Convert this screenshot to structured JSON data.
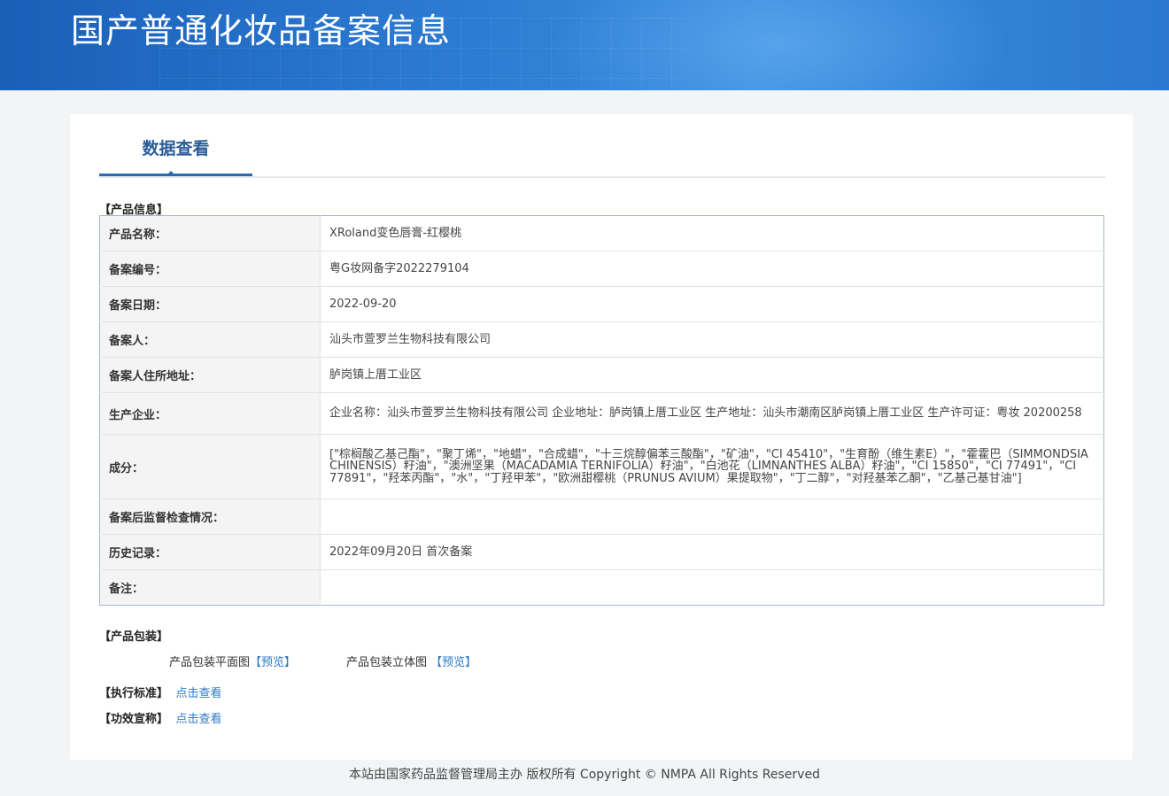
{
  "header": {
    "title": "国产普通化妆品备案信息"
  },
  "tab": {
    "label": "数据查看"
  },
  "product_section": {
    "label": "【产品信息】"
  },
  "info_rows": [
    {
      "key": "产品名称：",
      "value": "XRoland变色唇膏-红樱桃"
    },
    {
      "key": "备案编号：",
      "value": "粤G妆网备字2022279104"
    },
    {
      "key": "备案日期：",
      "value": "2022-09-20"
    },
    {
      "key": "备案人：",
      "value": "汕头市萱罗兰生物科技有限公司"
    },
    {
      "key": "备案人住所地址：",
      "value": "胪岗镇上厝工业区"
    },
    {
      "key": "生产企业：",
      "value": "企业名称：汕头市萱罗兰生物科技有限公司 企业地址：胪岗镇上厝工业区 生产地址：汕头市潮南区胪岗镇上厝工业区 生产许可证：粤妆 20200258"
    },
    {
      "key": "成分：",
      "value": "[\"棕榈酸乙基己酯\"，\"聚丁烯\"，\"地蜡\"，\"合成蜡\"，\"十三烷醇偏苯三酸酯\"，\"矿油\"，\"CI 45410\"，\"生育酚（维生素E）\"，\"霍霍巴（SIMMONDSIA CHINENSIS）籽油\"，\"澳洲坚果（MACADAMIA TERNIFOLIA）籽油\"，\"白池花（LIMNANTHES ALBA）籽油\"，\"CI 15850\"，\"CI 77491\"，\"CI 77891\"，\"羟苯丙酯\"，\"水\"，\"丁羟甲苯\"，\"欧洲甜樱桃（PRUNUS AVIUM）果提取物\"，\"丁二醇\"，\"对羟基苯乙酮\"，\"乙基己基甘油\"]"
    },
    {
      "key": "备案后监督检查情况：",
      "value": ""
    },
    {
      "key": "历史记录：",
      "value": "2022年09月20日 首次备案"
    },
    {
      "key": "备注：",
      "value": ""
    }
  ],
  "packaging": {
    "label": "【产品包装】",
    "flat_label": "产品包装平面图",
    "flat_link": "【预览】",
    "solid_label": "产品包装立体图",
    "solid_link": "【预览】"
  },
  "standard": {
    "label": "【执行标准】",
    "link": "点击查看"
  },
  "efficacy": {
    "label": "【功效宣称】",
    "link": "点击查看"
  },
  "footer": {
    "text": "本站由国家药品监督管理局主办 版权所有 Copyright © NMPA All Rights Reserved"
  }
}
